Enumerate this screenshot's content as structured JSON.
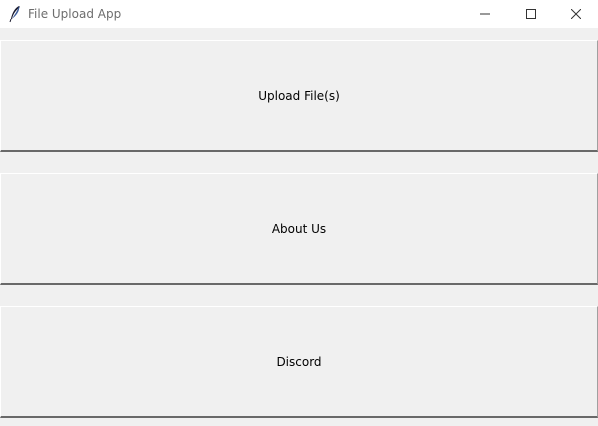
{
  "window": {
    "title": "File Upload App",
    "controls": {
      "minimize_icon": "minimize-icon",
      "maximize_icon": "maximize-icon",
      "close_icon": "close-icon"
    }
  },
  "buttons": {
    "upload_label": "Upload File(s)",
    "about_label": "About Us",
    "discord_label": "Discord"
  },
  "colors": {
    "window_bg": "#f0f0f0",
    "titlebar_bg": "#ffffff",
    "title_text": "#6d6d6d"
  }
}
